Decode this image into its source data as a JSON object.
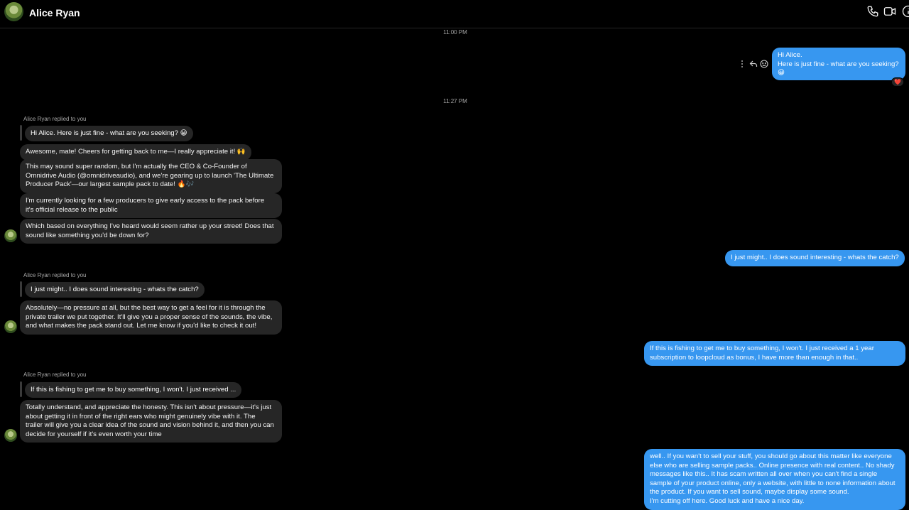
{
  "header": {
    "contact_name": "Alice Ryan"
  },
  "timestamps": {
    "t1": "11:00 PM",
    "t2": "11:27 PM"
  },
  "messages": {
    "out1": "Hi Alice.\nHere is just fine - what are you seeking?\n😀",
    "out1_reaction": "❤️",
    "replied_label": "Alice Ryan replied to you",
    "quote1": "Hi Alice. Here is just fine - what are you seeking? 😀",
    "in1": "Awesome, mate! Cheers for getting back to me—I really appreciate it! 🙌",
    "in2": "This may sound super random, but I'm actually the CEO & Co-Founder of\nOmnidrive Audio (@omnidriveaudio), and we're gearing up to launch 'The Ultimate\nProducer Pack'—our largest sample pack to date! 🔥🎶",
    "in3": "I'm currently looking for a few producers to give early access to the pack before\nit's official release to the public",
    "in4": "Which based on everything I've heard would seem rather up your street! Does that\nsound like something you'd be down for?",
    "out2": "I just might.. I does sound interesting - whats the catch?",
    "quote2": "I just might.. I does sound interesting - whats the catch?",
    "in5": "Absolutely—no pressure at all, but the best way to get a feel for it is through the\nprivate trailer we put together. It'll give you a proper sense of the sounds, the vibe,\nand what makes the pack stand out. Let me know if you'd like to check it out!",
    "out3": "If this is fishing to get me to buy something, I won't. I just received a 1 year\nsubscription to loopcloud as bonus, I have more than enough in that..",
    "quote3": "If this is fishing to get me to buy something, I won't. I just received ...",
    "in6": "Totally understand, and appreciate the honesty. This isn't about pressure—it's just\nabout getting it in front of the right ears who might genuinely vibe with it. The\ntrailer will give you a clear idea of the sound and vision behind it, and then you can\ndecide for yourself if it's even worth your time",
    "out4": "well.. If you wan't to sell your stuff, you should go about this matter like everyone\nelse who are selling sample packs..  Online presence with real content.. No shady\nmessages like this.. It has scam written all over when you can't find a single\nsample of your product online, only a website, with little to none information about\nthe product. If you want to sell sound, maybe display some sound.\nI'm cutting off here. Good luck and have a nice day."
  },
  "icons": {
    "call": "phone-icon",
    "video": "video-camera-icon",
    "info": "info-icon"
  },
  "colors": {
    "outgoing": "#3797f0",
    "incoming": "#262626",
    "background": "#000000"
  }
}
